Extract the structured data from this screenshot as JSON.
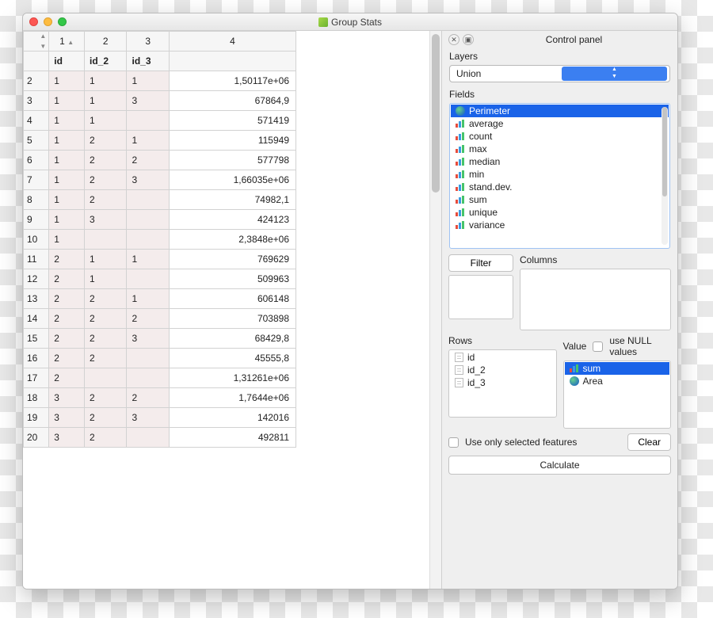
{
  "window": {
    "title": "Group Stats"
  },
  "control_panel": {
    "title": "Control panel",
    "layers_label": "Layers",
    "layers_value": "Union",
    "fields_label": "Fields",
    "fields": [
      {
        "icon": "globe",
        "label": "Perimeter",
        "selected": true
      },
      {
        "icon": "bars",
        "label": "average"
      },
      {
        "icon": "bars",
        "label": "count"
      },
      {
        "icon": "bars",
        "label": "max"
      },
      {
        "icon": "bars",
        "label": "median"
      },
      {
        "icon": "bars",
        "label": "min"
      },
      {
        "icon": "bars",
        "label": "stand.dev."
      },
      {
        "icon": "bars",
        "label": "sum"
      },
      {
        "icon": "bars",
        "label": "unique"
      },
      {
        "icon": "bars",
        "label": "variance"
      }
    ],
    "filter_button": "Filter",
    "columns_label": "Columns",
    "rows_label": "Rows",
    "value_label": "Value",
    "use_null_label": "use NULL values",
    "rows_items": [
      {
        "icon": "page",
        "label": "id"
      },
      {
        "icon": "page",
        "label": "id_2"
      },
      {
        "icon": "page",
        "label": "id_3"
      }
    ],
    "value_items": [
      {
        "icon": "bars",
        "label": "sum",
        "selected": true
      },
      {
        "icon": "globe",
        "label": "Area"
      }
    ],
    "use_selected_label": "Use only selected features",
    "clear_button": "Clear",
    "calculate_button": "Calculate"
  },
  "table": {
    "super_headers": [
      "",
      "1",
      "2",
      "3",
      "4"
    ],
    "headers": [
      "",
      "id",
      "id_2",
      "id_3",
      ""
    ],
    "rows": [
      {
        "n": "2",
        "c": [
          "1",
          "1",
          "1"
        ],
        "v": "1,50117e+06"
      },
      {
        "n": "3",
        "c": [
          "1",
          "1",
          "3"
        ],
        "v": "67864,9"
      },
      {
        "n": "4",
        "c": [
          "1",
          "1",
          ""
        ],
        "v": "571419"
      },
      {
        "n": "5",
        "c": [
          "1",
          "2",
          "1"
        ],
        "v": "115949"
      },
      {
        "n": "6",
        "c": [
          "1",
          "2",
          "2"
        ],
        "v": "577798"
      },
      {
        "n": "7",
        "c": [
          "1",
          "2",
          "3"
        ],
        "v": "1,66035e+06"
      },
      {
        "n": "8",
        "c": [
          "1",
          "2",
          ""
        ],
        "v": "74982,1"
      },
      {
        "n": "9",
        "c": [
          "1",
          "3",
          ""
        ],
        "v": "424123"
      },
      {
        "n": "10",
        "c": [
          "1",
          "",
          ""
        ],
        "v": "2,3848e+06"
      },
      {
        "n": "11",
        "c": [
          "2",
          "1",
          "1"
        ],
        "v": "769629"
      },
      {
        "n": "12",
        "c": [
          "2",
          "1",
          ""
        ],
        "v": "509963"
      },
      {
        "n": "13",
        "c": [
          "2",
          "2",
          "1"
        ],
        "v": "606148"
      },
      {
        "n": "14",
        "c": [
          "2",
          "2",
          "2"
        ],
        "v": "703898"
      },
      {
        "n": "15",
        "c": [
          "2",
          "2",
          "3"
        ],
        "v": "68429,8"
      },
      {
        "n": "16",
        "c": [
          "2",
          "2",
          ""
        ],
        "v": "45555,8"
      },
      {
        "n": "17",
        "c": [
          "2",
          "",
          ""
        ],
        "v": "1,31261e+06"
      },
      {
        "n": "18",
        "c": [
          "3",
          "2",
          "2"
        ],
        "v": "1,7644e+06"
      },
      {
        "n": "19",
        "c": [
          "3",
          "2",
          "3"
        ],
        "v": "142016"
      },
      {
        "n": "20",
        "c": [
          "3",
          "2",
          ""
        ],
        "v": "492811"
      }
    ]
  }
}
